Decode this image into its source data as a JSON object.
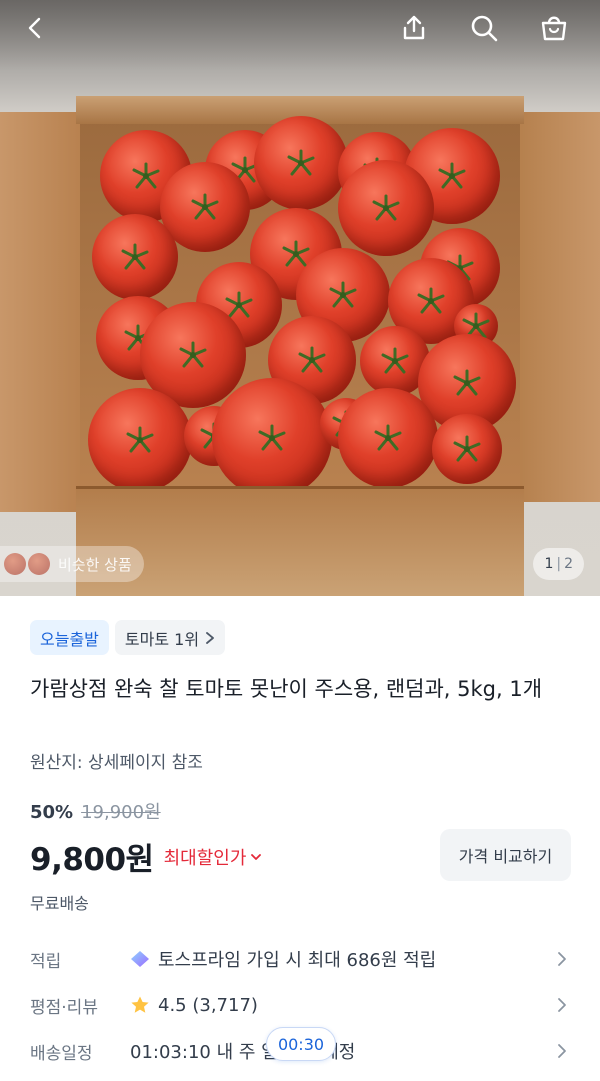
{
  "similar_products_label": "비슷한 상품",
  "gallery": {
    "current": "1",
    "total": "2"
  },
  "badges": {
    "today_ship": "오늘출발",
    "rank": "토마토 1위"
  },
  "product": {
    "title": "가람상점 완숙 찰 토마토 못난이 주스용, 랜덤과, 5kg, 1개",
    "origin": "원산지: 상세페이지 참조",
    "discount_percent": "50%",
    "original_price": "19,900원",
    "price": "9,800원",
    "max_discount_label": "최대할인가",
    "compare_button": "가격 비교하기",
    "shipping": "무료배송"
  },
  "info_rows": {
    "points_label": "적립",
    "points_value": "토스프라임 가입 시 최대 686원 적립",
    "rating_label": "평점·리뷰",
    "rating_value": "4.5 (3,717)",
    "delivery_label": "배송일정",
    "delivery_value": "01:03:10 내 주 일 도착 예정"
  },
  "timer_chip": "00:30",
  "icons": [
    "back-arrow-icon",
    "share-icon",
    "search-icon",
    "cart-bag-icon",
    "chevron-right-icon",
    "chevron-down-icon",
    "star-icon",
    "prime-gem-icon"
  ],
  "colors": {
    "accent_blue": "#1b64da",
    "discount_red": "#e42939",
    "star_yellow": "#ffc342"
  }
}
